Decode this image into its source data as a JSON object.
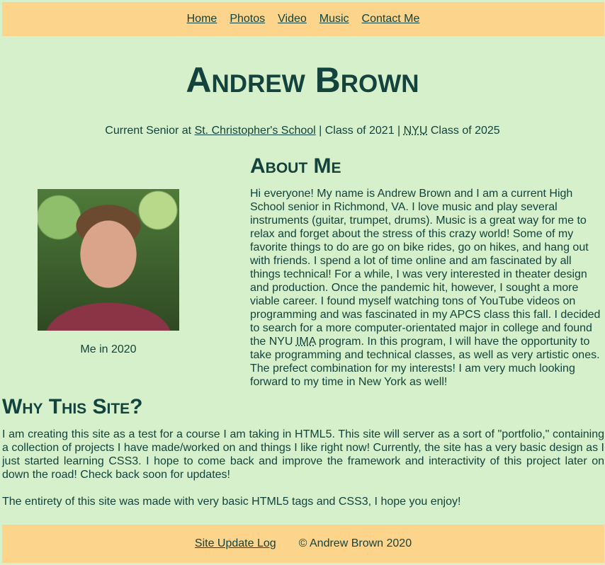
{
  "nav": {
    "items": [
      "Home",
      "Photos",
      "Video",
      "Music",
      "Contact Me"
    ]
  },
  "header": {
    "title": "Andrew Brown",
    "subtitle": {
      "prefix": "Current Senior at ",
      "school_link": "St. Christopher's School",
      "middle": " | Class of 2021 | ",
      "university_abbr": "NYU",
      "suffix": " Class of 2025"
    }
  },
  "photo": {
    "caption": "Me in 2020"
  },
  "about": {
    "heading": "About Me",
    "text_part1": "Hi everyone! My name is Andrew Brown and I am a current High School senior in Richmond, VA. I love music and play several instruments (guitar, trumpet, drums). Music is a great way for me to relax and forget about the stress of this crazy world! Some of my favorite things to do are go on bike rides, go on hikes, and hang out with friends. I spend a lot of time online and am fascinated by all things technical! For a while, I was very interested in theater design and production. Once the pandemic hit, however, I sought a more viable career. I found myself watching tons of YouTube videos on programming and was fascinated in my APCS class this fall. I decided to search for a more computer-orientated major in college and found the NYU ",
    "abbr": "IMA",
    "text_part2": " program. In this program, I will have the opportunity to take programming and technical classes, as well as very artistic ones. The prefect combination for my interests! I am very much looking forward to my time in New York as well!"
  },
  "why": {
    "heading": "Why This Site?",
    "paragraph1": "I am creating this site as a test for a course I am taking in HTML5. This site will server as a sort of \"portfolio,\" containing a collection of projects I have made/worked on and things I like right now! Currently, the site has a very basic design as I just started learning CSS3. I hope to come back and improve the framework and interactivity of this project later on down the road! Check back soon for updates!",
    "paragraph2": "The entirety of this site was made with very basic HTML5 tags and CSS3, I hope you enjoy!"
  },
  "footer": {
    "update_log_link": "Site Update Log",
    "copyright": "© Andrew Brown 2020"
  },
  "colors": {
    "background": "#d6f0cb",
    "bar": "#fdd48c",
    "text": "#13433c"
  }
}
